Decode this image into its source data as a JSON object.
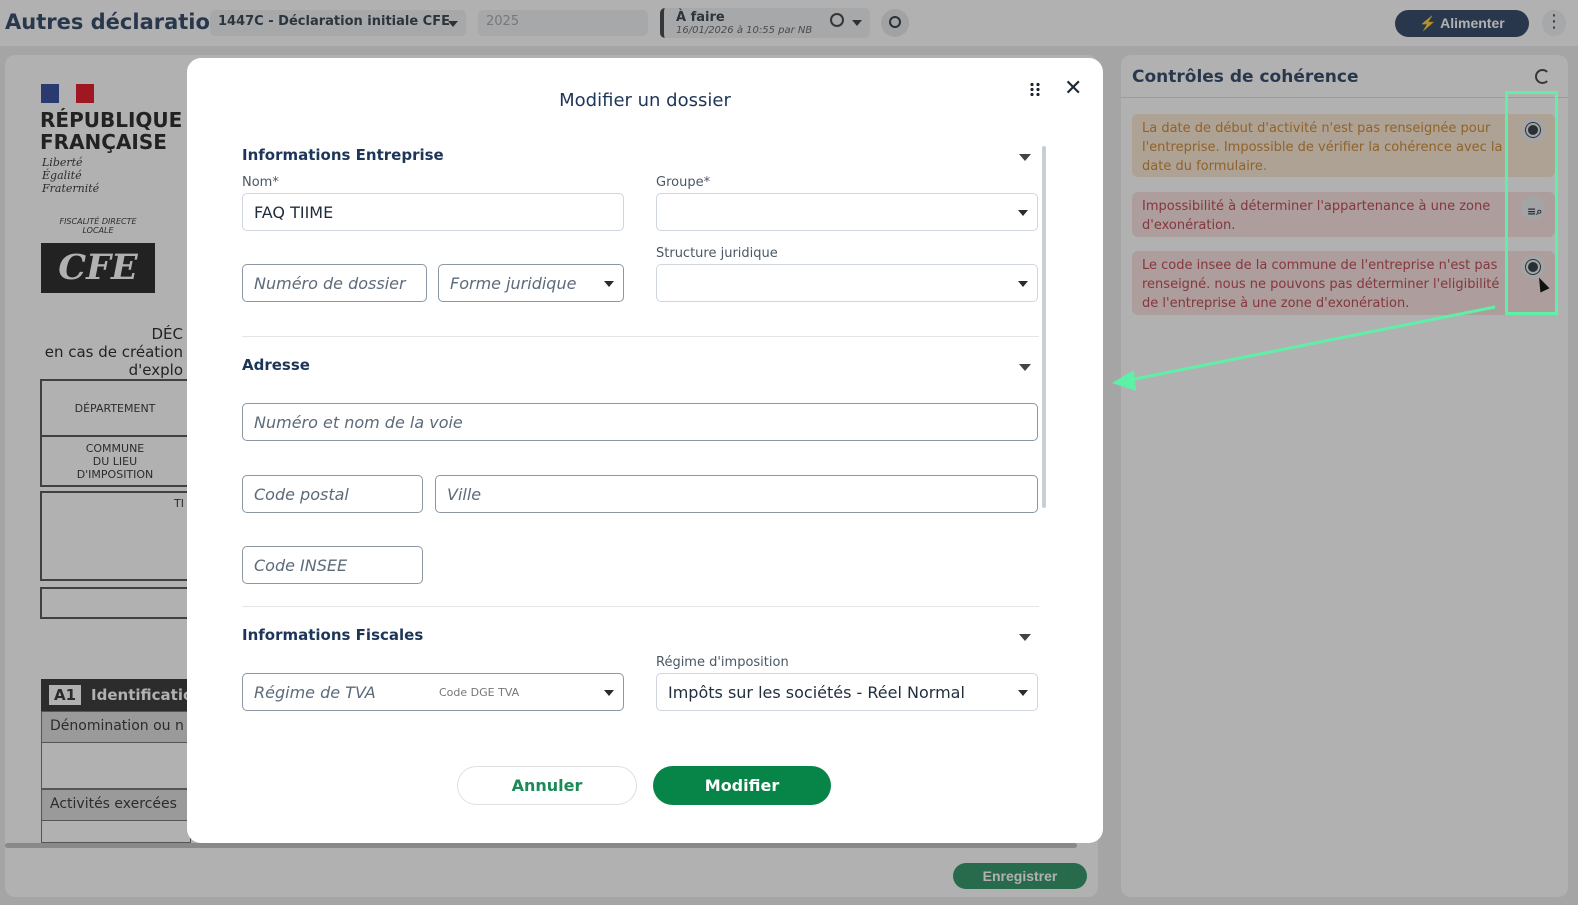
{
  "topbar": {
    "title": "Autres déclarations",
    "form_select": "1447C - Déclaration initiale CFE",
    "year": "2025",
    "status": "À faire",
    "status_sub": "16/01/2026 à 10:55 par NB",
    "alimenter_label": "Alimenter",
    "kebab": "⋮"
  },
  "document": {
    "republique": "RÉPUBLIQUE\nFRANÇAISE",
    "motto": [
      "Liberté",
      "Égalité",
      "Fraternité"
    ],
    "fiscal": "FISCALITÉ DIRECTE LOCALE",
    "cfe": "CFE",
    "heading": [
      "DÉC",
      "en cas de création",
      "d'explo"
    ],
    "departement": "DÉPARTEMENT",
    "commune": "COMMUNE\nDU LIEU\nD'IMPOSITION",
    "cell_t": "TI",
    "a1_num": "A1",
    "a1_text": "Identificatio",
    "denomination": "Dénomination ou n",
    "activites": "Activités exercées",
    "save_label": "Enregistrer"
  },
  "coherence": {
    "title": "Contrôles de cohérence",
    "alerts": [
      {
        "text": "La date de début d'activité n'est pas renseignée pour l'entreprise. Impossible de vérifier la cohérence avec la date du formulaire.",
        "level": "warning",
        "icon": "gear-icon"
      },
      {
        "text": "Impossibilité à déterminer l'appartenance à une zone d'exonération.",
        "level": "error",
        "icon": "search-list-icon"
      },
      {
        "text": "Le code insee de la commune de l'entreprise n'est pas renseigné. nous ne pouvons pas déterminer l'eligibilité de l'entreprise à une zone d'exonération.",
        "level": "error",
        "icon": "gear-icon"
      }
    ]
  },
  "modal": {
    "title": "Modifier un dossier",
    "close": "✕",
    "sections": {
      "entreprise": "Informations Entreprise",
      "adresse": "Adresse",
      "fiscales": "Informations Fiscales"
    },
    "fields": {
      "nom_label": "Nom*",
      "nom_value": "FAQ TIIME",
      "groupe_label": "Groupe*",
      "numero_placeholder": "Numéro de dossier",
      "forme_placeholder": "Forme juridique",
      "structure_label": "Structure juridique",
      "voie_placeholder": "Numéro et nom de la voie",
      "cp_placeholder": "Code postal",
      "ville_placeholder": "Ville",
      "insee_placeholder": "Code INSEE",
      "tva_placeholder": "Régime de TVA",
      "regime_label": "Régime d'imposition",
      "regime_value": "Impôts sur les sociétés - Réel Normal",
      "cut_label": "Code DGE TVA"
    },
    "annuler": "Annuler",
    "modifier": "Modifier"
  },
  "colors": {
    "brand": "#1d3557",
    "success": "#078548",
    "warning_bg": "#fbe7d0",
    "error_bg": "#f8dede",
    "highlight": "#5ff0a8"
  }
}
